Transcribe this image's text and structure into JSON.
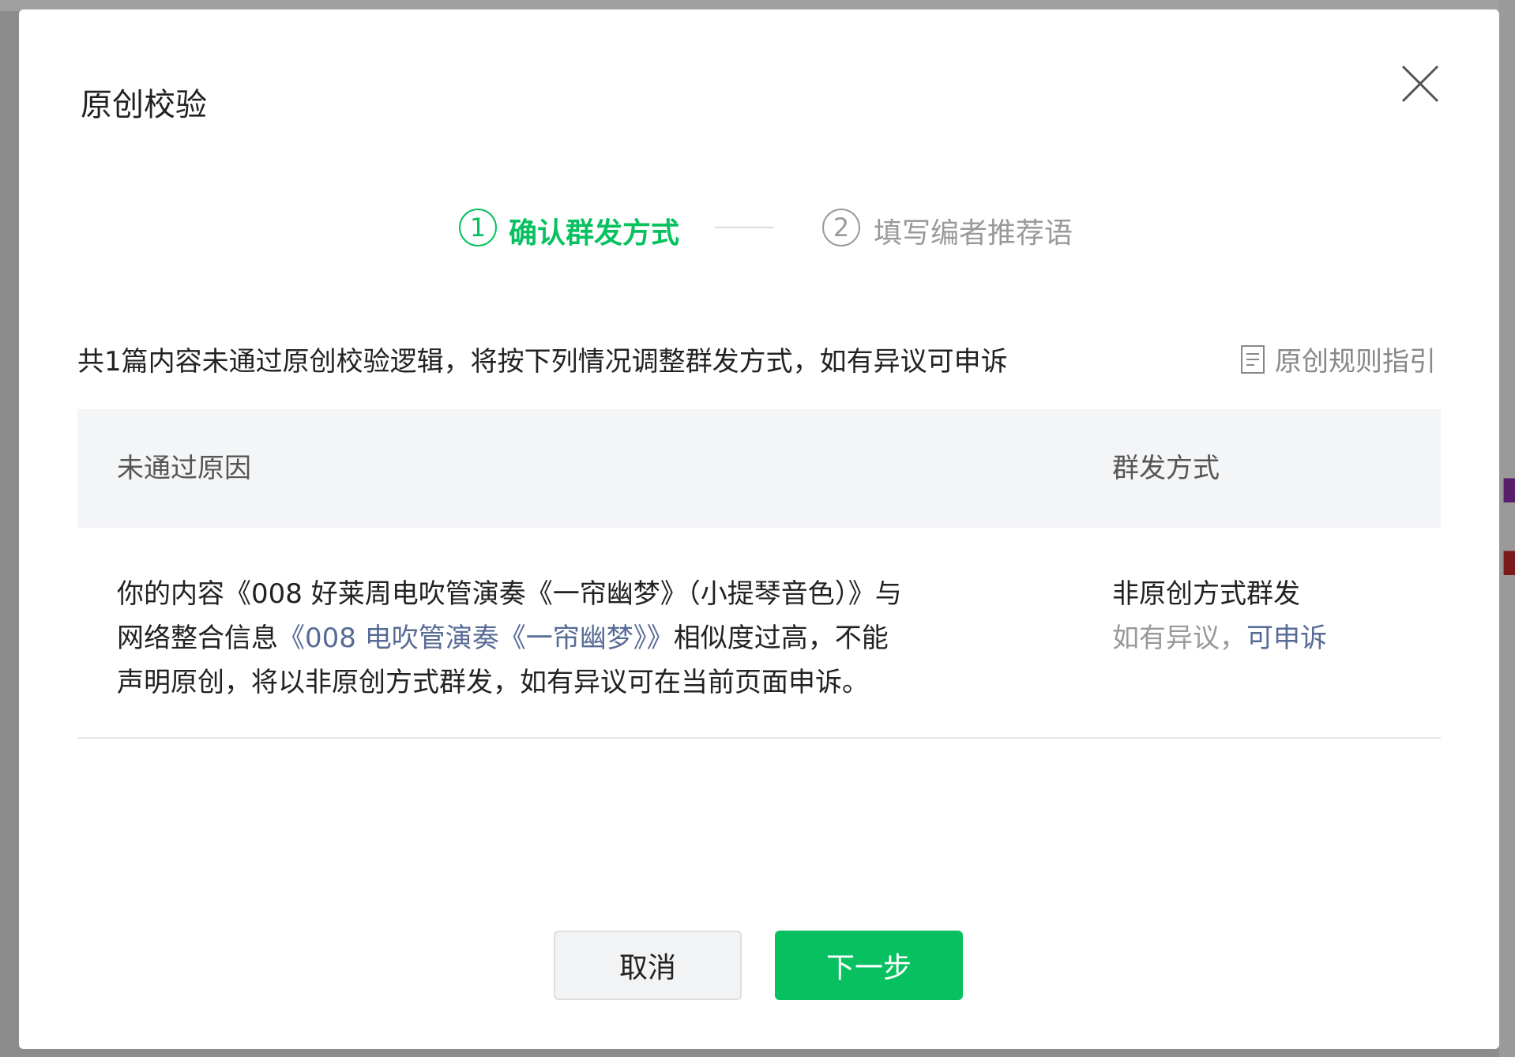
{
  "dialog": {
    "title": "原创校验",
    "steps": [
      {
        "number": "1",
        "label": "确认群发方式",
        "state": "active"
      },
      {
        "number": "2",
        "label": "填写编者推荐语",
        "state": "inactive"
      }
    ],
    "notice": "共1篇内容未通过原创校验逻辑，将按下列情况调整群发方式，如有异议可申诉",
    "guide_link": "原创规则指引",
    "table": {
      "headers": {
        "reason": "未通过原因",
        "method": "群发方式"
      },
      "row": {
        "reason_prefix": "你的内容《008 好莱周电吹管演奏《一帘幽梦》（小提琴音色）》与网络整合信息",
        "reason_link": "《008 电吹管演奏《一帘幽梦》》",
        "reason_suffix": "相似度过高，不能声明原创，将以非原创方式群发，如有异议可在当前页面申诉。",
        "method": "非原创方式群发",
        "dispute_prefix": "如有异议，",
        "dispute_link": "可申诉"
      }
    },
    "buttons": {
      "cancel": "取消",
      "next": "下一步"
    }
  },
  "colors": {
    "accent": "#07c160",
    "link": "#576b95"
  },
  "icons": {
    "close": "close-icon",
    "guide": "document-icon"
  }
}
